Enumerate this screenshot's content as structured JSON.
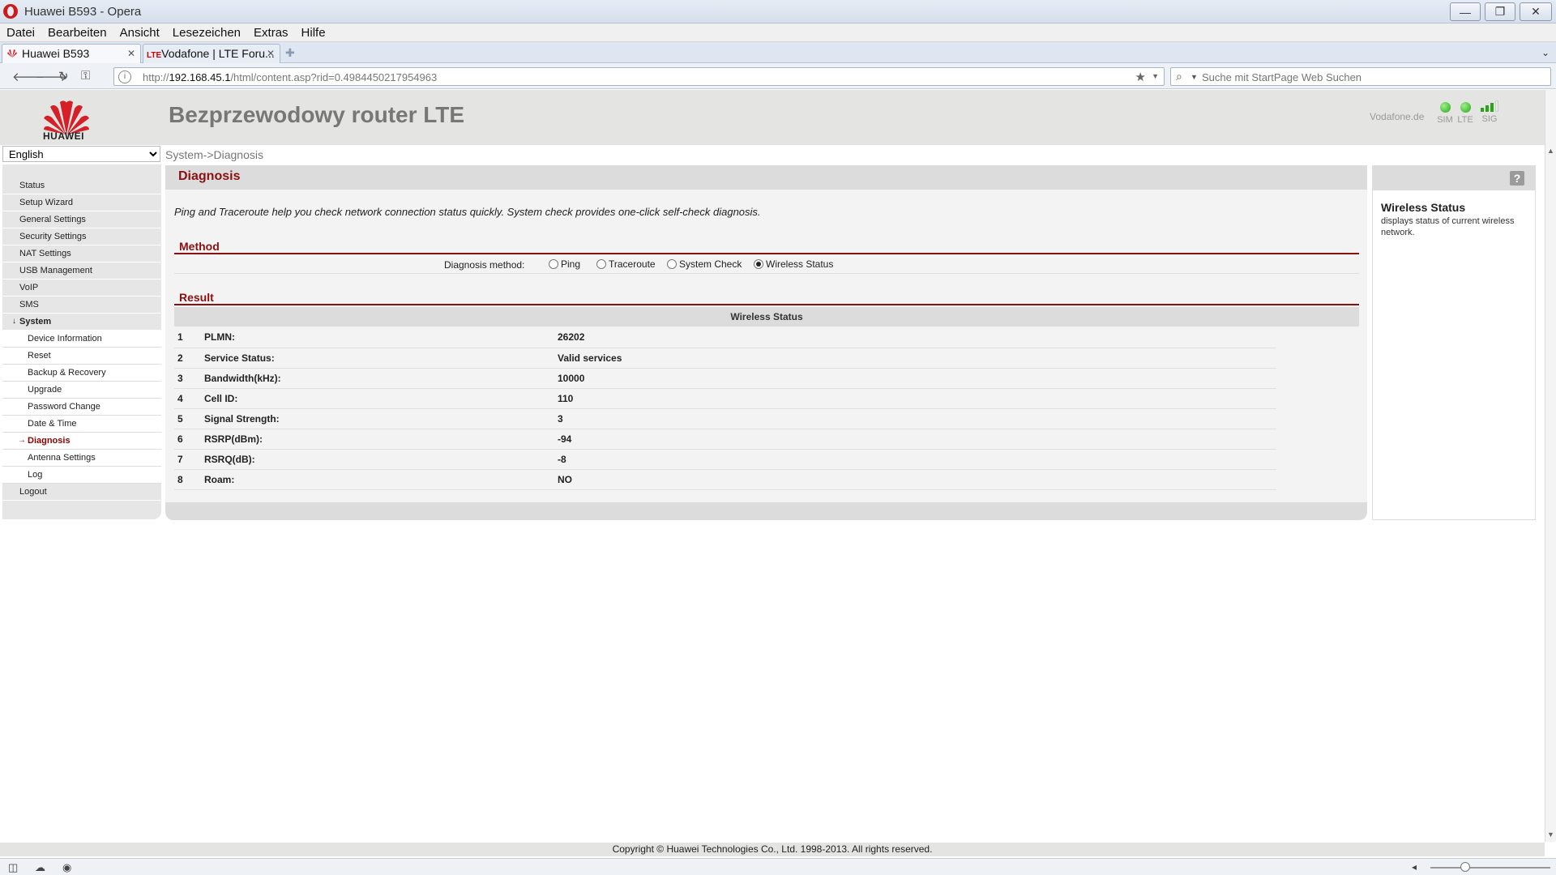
{
  "window": {
    "title": "Huawei B593 - Opera",
    "buttons": {
      "minimize": "—",
      "restore": "❐",
      "close": "✕"
    }
  },
  "menu": [
    "Datei",
    "Bearbeiten",
    "Ansicht",
    "Lesezeichen",
    "Extras",
    "Hilfe"
  ],
  "tabs": [
    {
      "label": "Huawei B593",
      "active": true
    },
    {
      "label": "Vodafone | LTE Foru...",
      "favicon_text": "LTE",
      "active": false
    }
  ],
  "address": {
    "prefix": "http://",
    "host": "192.168.45.1",
    "path": "/html/content.asp?rid=0.4984450217954963"
  },
  "search": {
    "placeholder": "Suche mit StartPage Web Suchen"
  },
  "router": {
    "brand": "HUAWEI",
    "title": "Bezprzewodowy router LTE",
    "operator": "Vodafone.de",
    "indicators": {
      "sim": "SIM",
      "lte": "LTE",
      "sig": "SIG"
    },
    "signal_bars": 3,
    "signal_bars_total": 4,
    "colors": {
      "accent": "#8b1010",
      "indicator_green": "#27a31a",
      "logo_red": "#d61f26"
    }
  },
  "language": {
    "selected": "English"
  },
  "breadcrumb": "System->Diagnosis",
  "sidebar": {
    "items": [
      {
        "label": "Status"
      },
      {
        "label": "Setup Wizard"
      },
      {
        "label": "General Settings"
      },
      {
        "label": "Security Settings"
      },
      {
        "label": "NAT Settings"
      },
      {
        "label": "USB Management"
      },
      {
        "label": "VoIP"
      },
      {
        "label": "SMS"
      },
      {
        "label": "System",
        "expanded": true,
        "children": [
          {
            "label": "Device Information"
          },
          {
            "label": "Reset"
          },
          {
            "label": "Backup & Recovery"
          },
          {
            "label": "Upgrade"
          },
          {
            "label": "Password Change"
          },
          {
            "label": "Date & Time"
          },
          {
            "label": "Diagnosis",
            "active": true
          },
          {
            "label": "Antenna Settings"
          },
          {
            "label": "Log"
          }
        ]
      },
      {
        "label": "Logout"
      }
    ]
  },
  "diagnosis": {
    "title": "Diagnosis",
    "intro": "Ping and Traceroute help you check network connection status quickly. System check provides one-click self-check diagnosis.",
    "method_title": "Method",
    "method_label": "Diagnosis method:",
    "methods": [
      "Ping",
      "Traceroute",
      "System Check",
      "Wireless Status"
    ],
    "selected_method": "Wireless Status",
    "result_title": "Result",
    "result_header": "Wireless Status",
    "rows": [
      {
        "n": "1",
        "key": "PLMN:",
        "value": "26202"
      },
      {
        "n": "2",
        "key": "Service Status:",
        "value": "Valid services"
      },
      {
        "n": "3",
        "key": "Bandwidth(kHz):",
        "value": "10000"
      },
      {
        "n": "4",
        "key": "Cell ID:",
        "value": "110"
      },
      {
        "n": "5",
        "key": "Signal Strength:",
        "value": "3"
      },
      {
        "n": "6",
        "key": "RSRP(dBm):",
        "value": "-94"
      },
      {
        "n": "7",
        "key": "RSRQ(dB):",
        "value": "-8"
      },
      {
        "n": "8",
        "key": "Roam:",
        "value": "NO"
      }
    ]
  },
  "help": {
    "icon": "?",
    "title": "Wireless Status",
    "text": "displays status of current wireless network."
  },
  "footer": {
    "copyright": "Copyright © Huawei Technologies Co., Ltd. 1998-2013. All rights reserved."
  }
}
